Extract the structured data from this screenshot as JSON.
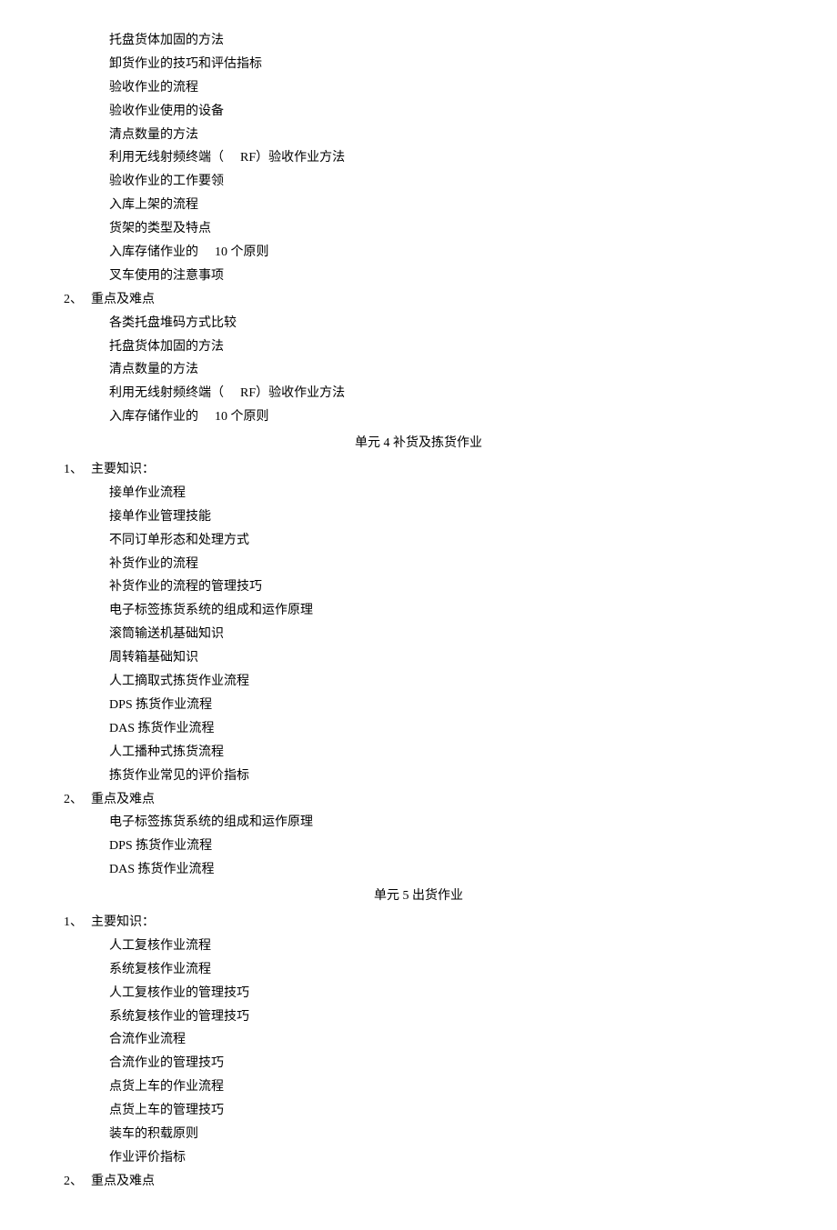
{
  "block1": {
    "items": [
      "托盘货体加固的方法",
      "卸货作业的技巧和评估指标",
      "验收作业的流程",
      "验收作业使用的设备",
      "清点数量的方法"
    ],
    "rf_prefix": "利用无线射频终端（",
    "rf_mid": "RF）验收作业方法",
    "items2": [
      "验收作业的工作要领",
      "入库上架的流程",
      "货架的类型及特点"
    ],
    "storage_prefix": "入库存储作业的",
    "storage_suffix": "10 个原则",
    "items3": [
      "叉车使用的注意事项"
    ]
  },
  "num2": "2、",
  "heading_important": "重点及难点",
  "block2": {
    "items": [
      "各类托盘堆码方式比较",
      "托盘货体加固的方法",
      "清点数量的方法"
    ],
    "rf_prefix": "利用无线射频终端（",
    "rf_mid": "RF）验收作业方法",
    "storage_prefix": "入库存储作业的",
    "storage_suffix": "10 个原则"
  },
  "unit4_title": "单元 4 补货及拣货作业",
  "num1": "1、",
  "heading_main": "主要知识：",
  "block3": {
    "items": [
      "接单作业流程",
      "接单作业管理技能",
      "不同订单形态和处理方式",
      "补货作业的流程",
      "补货作业的流程的管理技巧",
      "电子标签拣货系统的组成和运作原理",
      "滚筒输送机基础知识",
      "周转箱基础知识",
      "人工摘取式拣货作业流程",
      "DPS 拣货作业流程",
      "DAS 拣货作业流程",
      "人工播种式拣货流程",
      "拣货作业常见的评价指标"
    ]
  },
  "block4": {
    "items": [
      "电子标签拣货系统的组成和运作原理",
      "DPS 拣货作业流程",
      "DAS 拣货作业流程"
    ]
  },
  "unit5_title": "单元 5 出货作业",
  "block5": {
    "items": [
      "人工复核作业流程",
      "系统复核作业流程",
      "人工复核作业的管理技巧",
      "系统复核作业的管理技巧",
      "合流作业流程",
      "合流作业的管理技巧",
      "点货上车的作业流程",
      "点货上车的管理技巧",
      "装车的积载原则",
      "作业评价指标"
    ]
  }
}
